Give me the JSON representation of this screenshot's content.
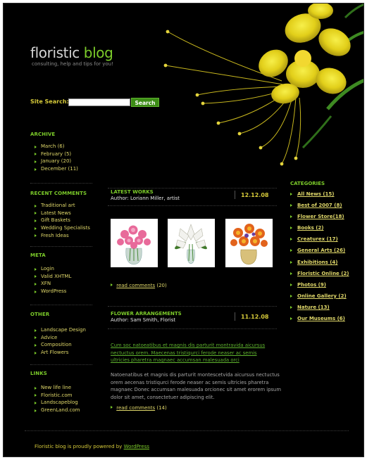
{
  "logo": {
    "word1": "floristic",
    "word2": "blog"
  },
  "tagline": "consulting, help and tips for you!",
  "search": {
    "label": "Site Search:",
    "button": "Search"
  },
  "sidebar": {
    "archive": {
      "heading": "ARCHIVE",
      "items": [
        "March (6)",
        "February (5)",
        "January (20)",
        "December (11)"
      ]
    },
    "recent_comments": {
      "heading": "RECENT COMMENTS",
      "items": [
        "Traditional art",
        "Latest News",
        "Gift Baskets",
        "Wedding Specialists",
        "Fresh Ideas"
      ]
    },
    "meta": {
      "heading": "META",
      "items": [
        "Login",
        "Valid XHTML",
        "XFN",
        "WordPress"
      ]
    },
    "other": {
      "heading": "OTHER",
      "items": [
        "Landscape Design",
        "Advice",
        "Composition",
        "Art Flowers"
      ]
    },
    "links": {
      "heading": "LINKS",
      "items": [
        "New life line",
        "Floristic.com",
        "Landscapeblog",
        "GreenLand.com"
      ]
    }
  },
  "posts": [
    {
      "title": "LATEST WORKS",
      "author": "Author: Loriann Miller, artist",
      "date": "12.12.08",
      "read_comments": "read comments",
      "count": "(20)"
    },
    {
      "title": "FLOWER ARRANGEMENTS",
      "author": "Author: Sam Smith, Florist",
      "date": "11.12.08",
      "green_text": "Cum soc natoeatibus et magnis dis parturit montravida aicursus nectuctus orem. Maecenas tristiqurci ferode neaser ac semis ultricies pharetra magnaec accumsan malesuada orci",
      "body_text": "Natoenatibus et magnis dis parturit montescetvida aicursus nectuctus orem aecenas tristiqurci ferode neaser ac semis ultricies pharetra magnaec Donec accumsan malesuada orcionec sit amet erorem ipsum dolor sit amet, consectetuer adipiscing elit.",
      "read_comments": "read comments",
      "count": "(14)"
    }
  ],
  "categories": {
    "heading": "CATEGORIES",
    "items": [
      "All News (15)",
      "Best of 2007 (8)",
      "Flower Store(18)",
      "Books (2)",
      "Creaturex (17)",
      "General Arts (26)",
      "Exhibitions (4)",
      "Floristic Online (2)",
      "Photos (9)",
      "Online Gallery (2)",
      "Nature (13)",
      "Our Museums (6)"
    ]
  },
  "footer": {
    "text": "Floristic blog is proudly powered by",
    "link": "WordPress"
  },
  "colors": {
    "green": "#7ccc2a",
    "yellow": "#e0d86a",
    "background": "#000000"
  }
}
